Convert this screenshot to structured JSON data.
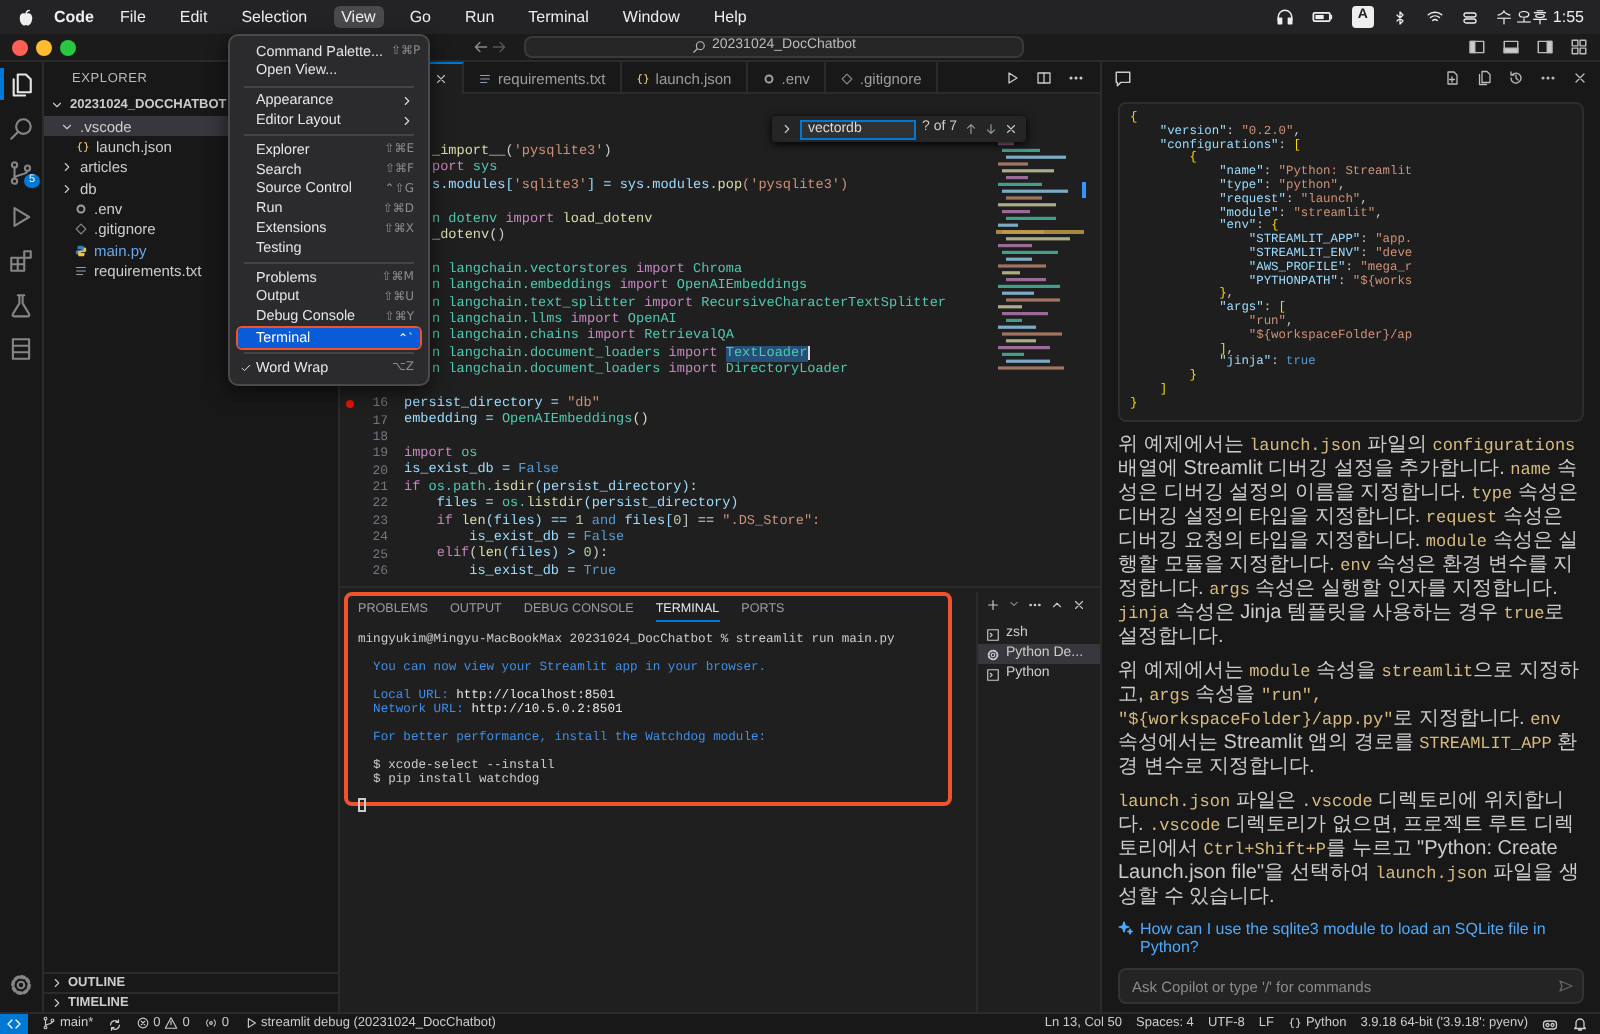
{
  "menubar": {
    "app": "Code",
    "items": [
      {
        "label": "File",
        "selected": false
      },
      {
        "label": "Edit",
        "selected": false
      },
      {
        "label": "Selection",
        "selected": false
      },
      {
        "label": "View",
        "selected": true
      },
      {
        "label": "Go",
        "selected": false
      },
      {
        "label": "Run",
        "selected": false
      },
      {
        "label": "Terminal",
        "selected": false
      },
      {
        "label": "Window",
        "selected": false
      },
      {
        "label": "Help",
        "selected": false
      }
    ],
    "input_source": "A",
    "clock": "수 오후 1:55"
  },
  "titlebar": {
    "search": "20231024_DocChatbot"
  },
  "activity_bar": {
    "items": [
      {
        "selected": true
      },
      {
        "selected": false
      },
      {
        "selected": false,
        "badge": "5"
      },
      {
        "selected": false
      },
      {
        "selected": false
      },
      {
        "selected": false
      },
      {
        "selected": false
      }
    ]
  },
  "sidebar": {
    "title": "EXPLORER",
    "root": {
      "label": "20231024_DOCCHATBOT",
      "expanded": true
    },
    "tree": [
      {
        "label": ".vscode",
        "kind": "folder",
        "expanded": true,
        "selected": true,
        "modified": false,
        "children": [
          {
            "label": "launch.json",
            "kind": "json-file",
            "selected": false,
            "modified": false
          }
        ]
      },
      {
        "label": "articles",
        "kind": "folder",
        "expanded": false,
        "selected": false,
        "modified": false
      },
      {
        "label": "db",
        "kind": "folder",
        "expanded": false,
        "selected": false,
        "modified": false
      },
      {
        "label": ".env",
        "kind": "env-file",
        "selected": false,
        "modified": false
      },
      {
        "label": ".gitignore",
        "kind": "ignore-file",
        "selected": false,
        "modified": false
      },
      {
        "label": "main.py",
        "kind": "python-file",
        "selected": false,
        "modified": true
      },
      {
        "label": "requirements.txt",
        "kind": "text-file",
        "selected": false,
        "modified": false
      }
    ],
    "sections": [
      {
        "label": "OUTLINE",
        "expanded": false
      },
      {
        "label": "TIMELINE",
        "expanded": false
      }
    ]
  },
  "editor": {
    "tabs": [
      {
        "kind": "covered",
        "selected": true
      },
      {
        "kind": "text-file",
        "label": "requirements.txt",
        "selected": false
      },
      {
        "kind": "json-file",
        "label": "launch.json",
        "selected": false
      },
      {
        "kind": "env-file",
        "label": ".env",
        "selected": false
      },
      {
        "kind": "ignore-file",
        "label": ".gitignore",
        "selected": false
      }
    ],
    "find": {
      "value": "vectordb",
      "count": "? of 7"
    },
    "lines": [
      {
        "kind": "code",
        "breakpoint": false,
        "cursor": false,
        "segments": [
          {
            "t": "_import__",
            "color": "#dcdcaa"
          },
          {
            "t": "(",
            "color": "#cccccc"
          },
          {
            "t": "'pysqlite3'",
            "color": "#ce9178"
          },
          {
            "t": ")",
            "color": "#cccccc"
          }
        ]
      },
      {
        "kind": "code",
        "breakpoint": false,
        "cursor": false,
        "segments": [
          {
            "t": "port",
            "color": "#c586c0"
          },
          {
            "t": " sys",
            "color": "#4ec9b0"
          }
        ]
      },
      {
        "kind": "code",
        "breakpoint": false,
        "cursor": false,
        "segments": [
          {
            "t": "s.modules[",
            "color": "#9cdcfe"
          },
          {
            "t": "'sqlite3'",
            "color": "#ce9178"
          },
          {
            "t": "] = sys.modules.",
            "color": "#9cdcfe"
          },
          {
            "t": "pop",
            "color": "#dcdcaa"
          },
          {
            "t": "('pysqlite3')",
            "color": "#ce9178"
          }
        ]
      },
      {
        "kind": "blank",
        "breakpoint": false,
        "cursor": false
      },
      {
        "kind": "code",
        "breakpoint": false,
        "cursor": false,
        "segments": [
          {
            "t": "n dotenv ",
            "color": "#4ec9b0"
          },
          {
            "t": "import",
            "color": "#c586c0"
          },
          {
            "t": " load_dotenv",
            "color": "#dcdcaa"
          }
        ]
      },
      {
        "kind": "code",
        "breakpoint": false,
        "cursor": false,
        "segments": [
          {
            "t": "_dotenv",
            "color": "#dcdcaa"
          },
          {
            "t": "()",
            "color": "#cccccc"
          }
        ]
      },
      {
        "kind": "blank",
        "breakpoint": false,
        "cursor": false
      },
      {
        "kind": "code",
        "breakpoint": false,
        "cursor": false,
        "segments": [
          {
            "t": "n langchain.vectorstores ",
            "color": "#4ec9b0"
          },
          {
            "t": "import",
            "color": "#c586c0"
          },
          {
            "t": " Chroma",
            "color": "#4ec9b0"
          }
        ]
      },
      {
        "kind": "code",
        "breakpoint": false,
        "cursor": false,
        "segments": [
          {
            "t": "n langchain.embeddings ",
            "color": "#4ec9b0"
          },
          {
            "t": "import",
            "color": "#c586c0"
          },
          {
            "t": " OpenAIEmbeddings",
            "color": "#4ec9b0"
          }
        ]
      },
      {
        "kind": "code",
        "breakpoint": false,
        "cursor": false,
        "segments": [
          {
            "t": "n langchain.text_splitter ",
            "color": "#4ec9b0"
          },
          {
            "t": "import",
            "color": "#c586c0"
          },
          {
            "t": " RecursiveCharacterTextSplitter",
            "color": "#4ec9b0"
          }
        ]
      },
      {
        "kind": "code",
        "breakpoint": false,
        "cursor": false,
        "segments": [
          {
            "t": "n langchain.llms ",
            "color": "#4ec9b0"
          },
          {
            "t": "import",
            "color": "#c586c0"
          },
          {
            "t": " OpenAI",
            "color": "#4ec9b0"
          }
        ]
      },
      {
        "kind": "code",
        "breakpoint": false,
        "cursor": false,
        "segments": [
          {
            "t": "n langchain.chains ",
            "color": "#4ec9b0"
          },
          {
            "t": "import",
            "color": "#c586c0"
          },
          {
            "t": " RetrievalQA",
            "color": "#4ec9b0"
          }
        ]
      },
      {
        "kind": "code",
        "breakpoint": false,
        "cursor": true,
        "segments": [
          {
            "t": "n langchain.document_loaders ",
            "color": "#4ec9b0"
          },
          {
            "t": "import ",
            "color": "#c586c0"
          },
          {
            "t": "TextLoader",
            "highlighted": true
          }
        ]
      },
      {
        "kind": "code",
        "breakpoint": false,
        "cursor": false,
        "segments": [
          {
            "t": "n langchain.document_loaders ",
            "color": "#4ec9b0"
          },
          {
            "t": "import",
            "color": "#c586c0"
          },
          {
            "t": " DirectoryLoader",
            "color": "#4ec9b0"
          }
        ]
      },
      {
        "kind": "blank",
        "breakpoint": false,
        "cursor": false
      },
      {
        "kind": "code",
        "number": "16",
        "breakpoint": true,
        "cursor": false,
        "segments": [
          {
            "t": "persist_directory = ",
            "color": "#9cdcfe"
          },
          {
            "t": "\"db\"",
            "color": "#ce9178"
          }
        ]
      },
      {
        "kind": "code",
        "number": "17",
        "breakpoint": false,
        "cursor": false,
        "segments": [
          {
            "t": "embedding = ",
            "color": "#9cdcfe"
          },
          {
            "t": "OpenAIEmbeddings",
            "color": "#4ec9b0"
          },
          {
            "t": "()",
            "color": "#dcdcaa"
          }
        ]
      },
      {
        "kind": "blank",
        "number": "18",
        "breakpoint": false,
        "cursor": false
      },
      {
        "kind": "code",
        "number": "19",
        "breakpoint": false,
        "cursor": false,
        "segments": [
          {
            "t": "import",
            "color": "#c586c0"
          },
          {
            "t": " os",
            "color": "#4ec9b0"
          }
        ]
      },
      {
        "kind": "code",
        "number": "20",
        "breakpoint": false,
        "cursor": false,
        "segments": [
          {
            "t": "is_exist_db = ",
            "color": "#9cdcfe"
          },
          {
            "t": "False",
            "color": "#569cd6"
          }
        ]
      },
      {
        "kind": "code",
        "number": "21",
        "breakpoint": false,
        "cursor": false,
        "segments": [
          {
            "t": "if",
            "color": "#c586c0"
          },
          {
            "t": " os.path.",
            "color": "#4ec9b0"
          },
          {
            "t": "isdir",
            "color": "#dcdcaa"
          },
          {
            "t": "(persist_directory):",
            "color": "#9cdcfe"
          }
        ]
      },
      {
        "kind": "code",
        "number": "22",
        "breakpoint": false,
        "cursor": false,
        "segments": [
          {
            "t": "    files = ",
            "color": "#9cdcfe"
          },
          {
            "t": "os.",
            "color": "#4ec9b0"
          },
          {
            "t": "listdir",
            "color": "#dcdcaa"
          },
          {
            "t": "(persist_directory)",
            "color": "#9cdcfe"
          }
        ]
      },
      {
        "kind": "code",
        "number": "23",
        "breakpoint": false,
        "cursor": false,
        "segments": [
          {
            "t": "    if",
            "color": "#c586c0"
          },
          {
            "t": " len",
            "color": "#dcdcaa"
          },
          {
            "t": "(files) == ",
            "color": "#9cdcfe"
          },
          {
            "t": "1",
            "color": "#b5cea8"
          },
          {
            "t": " and",
            "color": "#569cd6"
          },
          {
            "t": " files[",
            "color": "#9cdcfe"
          },
          {
            "t": "0",
            "color": "#b5cea8"
          },
          {
            "t": "] == ",
            "color": "#cccccc"
          },
          {
            "t": "\".DS_Store\":",
            "color": "#ce9178"
          }
        ]
      },
      {
        "kind": "code",
        "number": "24",
        "breakpoint": false,
        "cursor": false,
        "segments": [
          {
            "t": "        is_exist_db = ",
            "color": "#9cdcfe"
          },
          {
            "t": "False",
            "color": "#569cd6"
          }
        ]
      },
      {
        "kind": "code",
        "number": "25",
        "breakpoint": false,
        "cursor": false,
        "segments": [
          {
            "t": "    elif",
            "color": "#c586c0"
          },
          {
            "t": "(",
            "color": "#cccccc"
          },
          {
            "t": "len",
            "color": "#dcdcaa"
          },
          {
            "t": "(files) > ",
            "color": "#9cdcfe"
          },
          {
            "t": "0",
            "color": "#b5cea8"
          },
          {
            "t": "):",
            "color": "#cccccc"
          }
        ]
      },
      {
        "kind": "code",
        "number": "26",
        "breakpoint": false,
        "cursor": false,
        "segments": [
          {
            "t": "        is_exist_db = ",
            "color": "#9cdcfe"
          },
          {
            "t": "True",
            "color": "#569cd6"
          }
        ]
      }
    ]
  },
  "view_menu": {
    "groups": [
      [
        {
          "label": "Command Palette...",
          "shortcut": "⇧⌘P",
          "submenu": false,
          "checked": false,
          "selected": false,
          "framed": false
        },
        {
          "label": "Open View...",
          "submenu": false,
          "checked": false,
          "selected": false,
          "framed": false
        }
      ],
      [
        {
          "label": "Appearance",
          "submenu": true,
          "checked": false,
          "selected": false,
          "framed": false
        },
        {
          "label": "Editor Layout",
          "submenu": true,
          "checked": false,
          "selected": false,
          "framed": false
        }
      ],
      [
        {
          "label": "Explorer",
          "shortcut": "⇧⌘E",
          "submenu": false,
          "checked": false,
          "selected": false,
          "framed": false
        },
        {
          "label": "Search",
          "shortcut": "⇧⌘F",
          "submenu": false,
          "checked": false,
          "selected": false,
          "framed": false
        },
        {
          "label": "Source Control",
          "shortcut": "⌃⇧G",
          "submenu": false,
          "checked": false,
          "selected": false,
          "framed": false
        },
        {
          "label": "Run",
          "shortcut": "⇧⌘D",
          "submenu": false,
          "checked": false,
          "selected": false,
          "framed": false
        },
        {
          "label": "Extensions",
          "shortcut": "⇧⌘X",
          "submenu": false,
          "checked": false,
          "selected": false,
          "framed": false
        },
        {
          "label": "Testing",
          "submenu": false,
          "checked": false,
          "selected": false,
          "framed": false
        }
      ],
      [
        {
          "label": "Problems",
          "shortcut": "⇧⌘M",
          "submenu": false,
          "checked": false,
          "selected": false,
          "framed": false
        },
        {
          "label": "Output",
          "shortcut": "⇧⌘U",
          "submenu": false,
          "checked": false,
          "selected": false,
          "framed": false
        },
        {
          "label": "Debug Console",
          "shortcut": "⇧⌘Y",
          "submenu": false,
          "checked": false,
          "selected": false,
          "framed": false
        },
        {
          "label": "Terminal",
          "shortcut": "⌃`",
          "submenu": false,
          "checked": false,
          "selected": true,
          "framed": true
        }
      ],
      [
        {
          "label": "Word Wrap",
          "shortcut": "⌥Z",
          "submenu": false,
          "checked": true,
          "selected": false,
          "framed": false
        }
      ]
    ]
  },
  "panel": {
    "framed": true,
    "tabs": [
      {
        "label": "PROBLEMS",
        "selected": false
      },
      {
        "label": "OUTPUT",
        "selected": false
      },
      {
        "label": "DEBUG CONSOLE",
        "selected": false
      },
      {
        "label": "TERMINAL",
        "selected": true
      },
      {
        "label": "PORTS",
        "selected": false
      }
    ],
    "blocks": [
      [
        [
          {
            "t": "mingyukim@Mingyu-MacBookMax 20231024_DocChatbot % streamlit run main.py",
            "color": "#cccccc"
          }
        ]
      ],
      [
        [
          {
            "t": "  You can now view your Streamlit app in your browser.",
            "color": "#3b8eea"
          }
        ]
      ],
      [
        [
          {
            "t": "  Local URL: ",
            "color": "#3b8eea"
          },
          {
            "t": "http://localhost:8501",
            "color": "#e5e5e5"
          }
        ],
        [
          {
            "t": "  Network URL: ",
            "color": "#3b8eea"
          },
          {
            "t": "http://10.5.0.2:8501",
            "color": "#e5e5e5"
          }
        ]
      ],
      [
        [
          {
            "t": "  For better performance, install the Watchdog module:",
            "color": "#3b8eea"
          }
        ]
      ],
      [
        [
          {
            "t": "  $ xcode-select --install",
            "color": "#cccccc"
          }
        ],
        [
          {
            "t": "  $ pip install watchdog",
            "color": "#cccccc"
          }
        ]
      ]
    ],
    "terminals": [
      {
        "label": "zsh",
        "kind": "shell",
        "selected": false
      },
      {
        "label": "Python De...",
        "kind": "debug",
        "selected": true
      },
      {
        "label": "Python",
        "kind": "shell",
        "selected": false
      }
    ]
  },
  "chat": {
    "code": [
      "{",
      "    \"version\": \"0.2.0\",",
      "    \"configurations\": [",
      "        {",
      "            \"name\": \"Python: Streamlit",
      "            \"type\": \"python\",",
      "            \"request\": \"launch\",",
      "            \"module\": \"streamlit\",",
      "            \"env\": {",
      "                \"STREAMLIT_APP\": \"app.",
      "                \"STREAMLIT_ENV\": \"deve",
      "                \"AWS_PROFILE\": \"mega_r",
      "                \"PYTHONPATH\": \"${works",
      "            },",
      "            \"args\": [",
      "                \"run\",",
      "                \"${workspaceFolder}/ap",
      "            ],",
      "            \"jinja\": true",
      "        }",
      "    ]",
      "}"
    ],
    "paragraphs": [
      [
        {
          "t": "위 예제에서는 ",
          "code": false
        },
        {
          "t": "launch.json",
          "code": true
        },
        {
          "t": " 파일의 ",
          "code": false
        },
        {
          "t": "configurations",
          "code": true
        },
        {
          "t": " 배열에 Streamlit 디버깅 설정을 추가합니다. ",
          "code": false
        },
        {
          "t": "name",
          "code": true
        },
        {
          "t": " 속성은 디버깅 설정의 이름을 지정합니다. ",
          "code": false
        },
        {
          "t": "type",
          "code": true
        },
        {
          "t": " 속성은 디버깅 설정의 타입을 지정합니다. ",
          "code": false
        },
        {
          "t": "request",
          "code": true
        },
        {
          "t": " 속성은 디버깅 요청의 타입을 지정합니다. ",
          "code": false
        },
        {
          "t": "module",
          "code": true
        },
        {
          "t": " 속성은 실행할 모듈을 지정합니다. ",
          "code": false
        },
        {
          "t": "env",
          "code": true
        },
        {
          "t": " 속성은 환경 변수를 지정합니다. ",
          "code": false
        },
        {
          "t": "args",
          "code": true
        },
        {
          "t": " 속성은 실행할 인자를 지정합니다. ",
          "code": false
        },
        {
          "t": "jinja",
          "code": true
        },
        {
          "t": " 속성은 Jinja 템플릿을 사용하는 경우 ",
          "code": false
        },
        {
          "t": "true",
          "code": true
        },
        {
          "t": "로 설정합니다.",
          "code": false
        }
      ],
      [
        {
          "t": "위 예제에서는 ",
          "code": false
        },
        {
          "t": "module",
          "code": true
        },
        {
          "t": " 속성을 ",
          "code": false
        },
        {
          "t": "streamlit",
          "code": true
        },
        {
          "t": "으로 지정하고, ",
          "code": false
        },
        {
          "t": "args",
          "code": true
        },
        {
          "t": " 속성을 ",
          "code": false
        },
        {
          "t": "\"run\", \"${workspaceFolder}/app.py\"",
          "code": true
        },
        {
          "t": "로 지정합니다. ",
          "code": false
        },
        {
          "t": "env",
          "code": true
        },
        {
          "t": " 속성에서는 Streamlit 앱의 경로를 ",
          "code": false
        },
        {
          "t": "STREAMLIT_APP",
          "code": true
        },
        {
          "t": " 환경 변수로 지정합니다.",
          "code": false
        }
      ],
      [
        {
          "t": "launch.json",
          "code": true
        },
        {
          "t": " 파일은 ",
          "code": false
        },
        {
          "t": ".vscode",
          "code": true
        },
        {
          "t": " 디렉토리에 위치합니다. ",
          "code": false
        },
        {
          "t": ".vscode",
          "code": true
        },
        {
          "t": " 디렉토리가 없으면, 프로젝트 루트 디렉토리에서 ",
          "code": false
        },
        {
          "t": "Ctrl+Shift+P",
          "code": true
        },
        {
          "t": "를 누르고 \"Python: Create Launch.json file\"을 선택하여 ",
          "code": false
        },
        {
          "t": "launch.json",
          "code": true
        },
        {
          "t": " 파일을 생성할 수 있습니다.",
          "code": false
        }
      ]
    ],
    "suggestion": "How can I use the sqlite3 module to load an SQLite file in Python?",
    "input": {
      "placeholder": "Ask Copilot or type '/' for commands"
    }
  },
  "status_bar": {
    "branch": "main*",
    "errors": "0",
    "warnings": "0",
    "ports": "0",
    "debug": "streamlit debug (20231024_DocChatbot)",
    "position": "Ln 13, Col 50",
    "indent": "Spaces: 4",
    "encoding": "UTF-8",
    "eol": "LF",
    "language": "Python",
    "interpreter": "3.9.18 64-bit ('3.9.18': pyenv)"
  }
}
